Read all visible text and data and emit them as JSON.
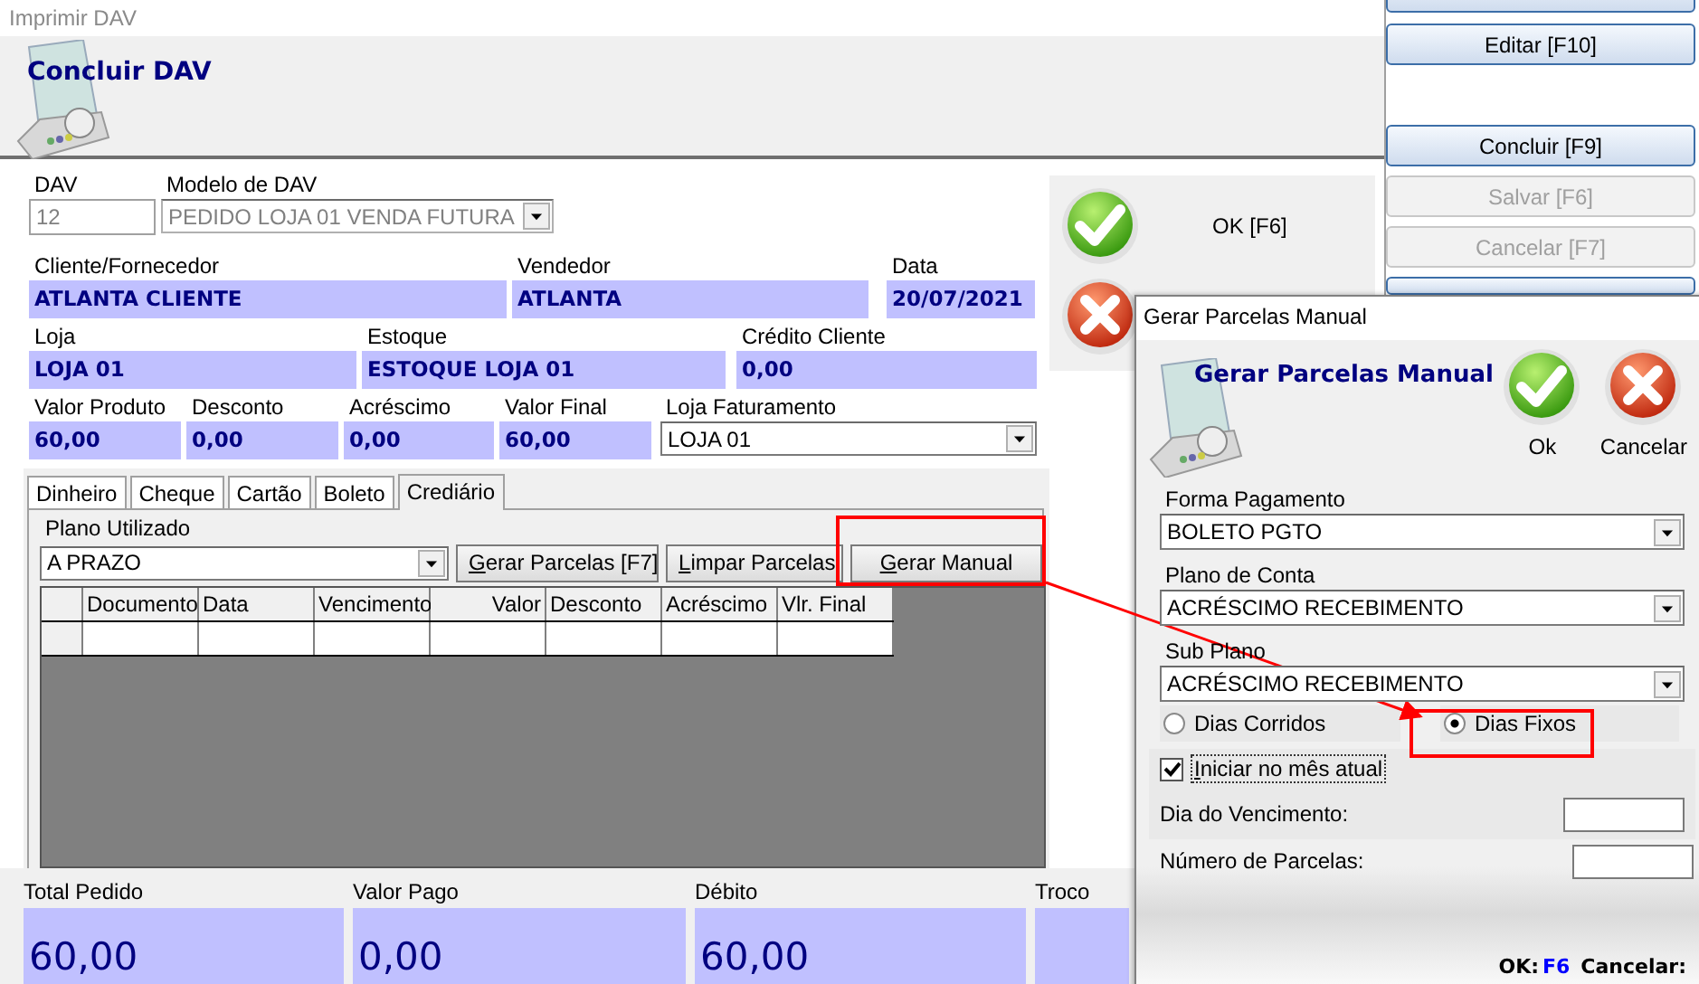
{
  "window": {
    "title": "Imprimir DAV"
  },
  "header": {
    "title": "Concluir DAV"
  },
  "top_fields": [
    {
      "label": "DAV",
      "value": "12",
      "kind": "input",
      "disabled": true
    },
    {
      "label": "Modelo de DAV",
      "value": "PEDIDO LOJA 01 VENDA FUTURA",
      "kind": "select",
      "disabled": true
    }
  ],
  "info_rows": [
    [
      {
        "label": "Cliente/Fornecedor",
        "value": "ATLANTA CLIENTE",
        "kind": "display"
      },
      {
        "label": "Vendedor",
        "value": "ATLANTA",
        "kind": "display"
      },
      {
        "label": "Data",
        "value": "20/07/2021",
        "kind": "display"
      }
    ],
    [
      {
        "label": "Loja",
        "value": "LOJA 01",
        "kind": "display"
      },
      {
        "label": "Estoque",
        "value": "ESTOQUE LOJA 01",
        "kind": "display"
      },
      {
        "label": "Crédito Cliente",
        "value": "0,00",
        "kind": "display"
      }
    ],
    [
      {
        "label": "Valor Produto",
        "value": "60,00",
        "kind": "display"
      },
      {
        "label": "Desconto",
        "value": "0,00",
        "kind": "display"
      },
      {
        "label": "Acréscimo",
        "value": "0,00",
        "kind": "display"
      },
      {
        "label": "Valor Final",
        "value": "60,00",
        "kind": "display"
      },
      {
        "label": "Loja Faturamento",
        "value": "LOJA 01",
        "kind": "select"
      }
    ]
  ],
  "actions": [
    {
      "kind": "ok",
      "label": "OK [F6]"
    },
    {
      "kind": "cancel"
    }
  ],
  "tabs": [
    {
      "label": "Dinheiro",
      "selected": false
    },
    {
      "label": "Cheque",
      "selected": false
    },
    {
      "label": "Cartão",
      "selected": false
    },
    {
      "label": "Boleto",
      "selected": false
    },
    {
      "label": "Crediário",
      "selected": true
    }
  ],
  "credit": {
    "plan_label": "Plano Utilizado",
    "plan_value": "A PRAZO",
    "buttons": [
      {
        "label": "Gerar Parcelas [F7]"
      },
      {
        "label": "Limpar Parcelas"
      },
      {
        "label": "Gerar Manual"
      }
    ],
    "table": {
      "columns": [
        "Documento",
        "Data",
        "Vencimento",
        "Valor",
        "Desconto",
        "Acréscimo",
        "Vlr. Final"
      ]
    }
  },
  "totals": [
    {
      "label": "Total Pedido",
      "value": "60,00"
    },
    {
      "label": "Valor Pago",
      "value": "0,00"
    },
    {
      "label": "Débito",
      "value": "60,00"
    },
    {
      "label": "Troco"
    }
  ],
  "side_buttons": [
    {
      "label": "Editar [F10]",
      "disabled": false
    },
    {
      "label": "Concluir [F9]",
      "disabled": false
    },
    {
      "label": "Salvar [F6]",
      "disabled": true
    },
    {
      "label": "Cancelar [F7]",
      "disabled": true
    }
  ],
  "dialog": {
    "title": "Gerar Parcelas Manual",
    "heading": "Gerar Parcelas Manual",
    "actions": [
      {
        "kind": "ok",
        "label": "Ok"
      },
      {
        "kind": "cancel",
        "label": "Cancelar"
      }
    ],
    "selects": [
      {
        "label": "Forma Pagamento",
        "value": "BOLETO PGTO"
      },
      {
        "label": "Plano de Conta",
        "value": "ACRÉSCIMO RECEBIMENTO"
      },
      {
        "label": "Sub Plano",
        "value": "ACRÉSCIMO RECEBIMENTO"
      }
    ],
    "radios": [
      {
        "label": "Dias Corridos",
        "selected": false
      },
      {
        "label": "Dias Fixos",
        "selected": true
      }
    ],
    "checkbox": {
      "label": "Iniciar no mês atual",
      "checked": true
    },
    "inputs": [
      {
        "label": "Dia do Vencimento:"
      },
      {
        "label": "Número de Parcelas:"
      }
    ],
    "shortcuts": [
      {
        "label": "OK:",
        "key": "F6"
      },
      {
        "label": "Cancelar:"
      }
    ]
  }
}
